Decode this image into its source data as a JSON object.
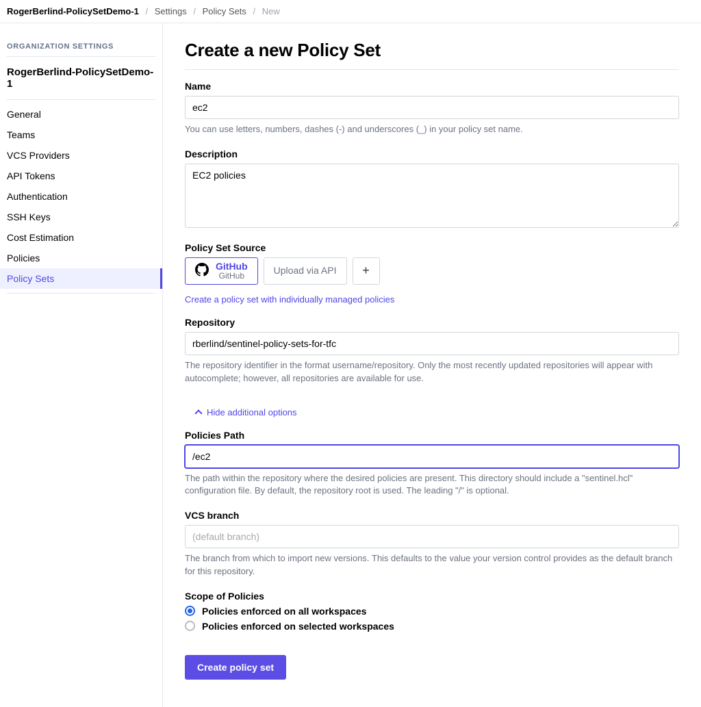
{
  "breadcrumb": {
    "org": "RogerBerlind-PolicySetDemo-1",
    "settings": "Settings",
    "section": "Policy Sets",
    "current": "New"
  },
  "sidebar": {
    "heading": "ORGANIZATION SETTINGS",
    "org_name": "RogerBerlind-PolicySetDemo-1",
    "items": [
      {
        "label": "General"
      },
      {
        "label": "Teams"
      },
      {
        "label": "VCS Providers"
      },
      {
        "label": "API Tokens"
      },
      {
        "label": "Authentication"
      },
      {
        "label": "SSH Keys"
      },
      {
        "label": "Cost Estimation"
      },
      {
        "label": "Policies"
      },
      {
        "label": "Policy Sets",
        "active": true
      }
    ]
  },
  "page": {
    "title": "Create a new Policy Set",
    "name": {
      "label": "Name",
      "value": "ec2",
      "hint": "You can use letters, numbers, dashes (-) and underscores (_) in your policy set name."
    },
    "description": {
      "label": "Description",
      "value": "EC2 policies"
    },
    "source": {
      "label": "Policy Set Source",
      "options": [
        {
          "title": "GitHub",
          "subtitle": "GitHub",
          "selected": true,
          "icon": "github-icon"
        },
        {
          "title": "Upload via API",
          "selected": false
        }
      ],
      "add_icon_label": "+",
      "manual_link": "Create a policy set with individually managed policies"
    },
    "repository": {
      "label": "Repository",
      "value": "rberlind/sentinel-policy-sets-for-tfc",
      "hint": "The repository identifier in the format username/repository. Only the most recently updated repositories will appear with autocomplete; however, all repositories are available for use."
    },
    "toggle": {
      "label": "Hide additional options"
    },
    "policies_path": {
      "label": "Policies Path",
      "value": "/ec2",
      "hint": "The path within the repository where the desired policies are present. This directory should include a \"sentinel.hcl\" configuration file. By default, the repository root is used. The leading \"/\" is optional."
    },
    "vcs_branch": {
      "label": "VCS branch",
      "placeholder": "(default branch)",
      "value": "",
      "hint": "The branch from which to import new versions. This defaults to the value your version control provides as the default branch for this repository."
    },
    "scope": {
      "label": "Scope of Policies",
      "options": [
        {
          "label": "Policies enforced on all workspaces",
          "checked": true
        },
        {
          "label": "Policies enforced on selected workspaces",
          "checked": false
        }
      ]
    },
    "submit": {
      "label": "Create policy set"
    }
  }
}
